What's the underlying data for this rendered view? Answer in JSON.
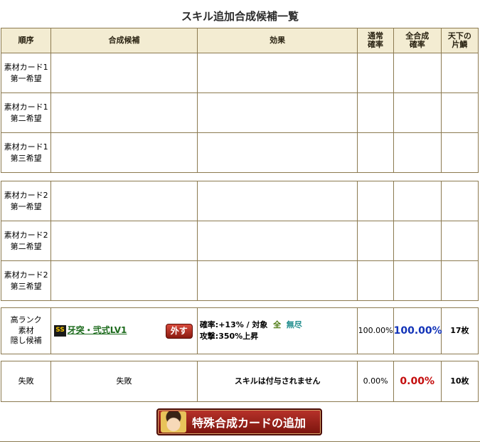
{
  "title": "スキル追加合成候補一覧",
  "header": {
    "order": "順序",
    "candidate": "合成候補",
    "effect": "効果",
    "normal_rate": "通常\n確率",
    "total_rate": "全合成\n確率",
    "tenka": "天下の\n片鱗"
  },
  "group1": {
    "rows": [
      {
        "label": "素材カード1\n第一希望"
      },
      {
        "label": "素材カード1\n第二希望"
      },
      {
        "label": "素材カード1\n第三希望"
      }
    ]
  },
  "group2": {
    "rows": [
      {
        "label": "素材カード2\n第一希望"
      },
      {
        "label": "素材カード2\n第二希望"
      },
      {
        "label": "素材カード2\n第三希望"
      }
    ]
  },
  "hidden": {
    "label": "高ランク\n素材\n隠し候補",
    "rank_badge": "SS",
    "skill_name": "牙突・弐式LV1",
    "remove_label": "外す",
    "effect_line1_prefix": "確率:+13% / 対象",
    "effect_kw_all": "全",
    "effect_kw_mujin": "無尽",
    "effect_line2": "攻撃:350%上昇",
    "normal_rate": "100.00%",
    "total_rate": "100.00%",
    "tenka": "17枚"
  },
  "fail": {
    "label": "失敗",
    "candidate": "失敗",
    "effect": "スキルは付与されません",
    "normal_rate": "0.00%",
    "total_rate": "0.00%",
    "tenka": "10枚"
  },
  "add_button": {
    "label": "特殊合成カードの追加"
  }
}
